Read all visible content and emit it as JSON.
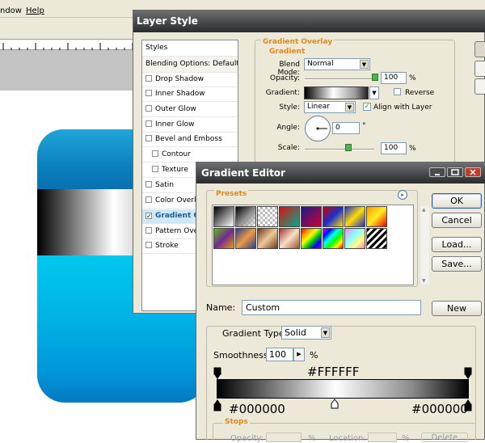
{
  "menubar": {
    "items": [
      "ndow",
      "Help"
    ]
  },
  "layer_style": {
    "title": "Layer Style",
    "list_header": "Styles",
    "items": [
      {
        "label": "Blending Options: Default",
        "checkbox": false
      },
      {
        "label": "Drop Shadow",
        "checkbox": true
      },
      {
        "label": "Inner Shadow",
        "checkbox": true
      },
      {
        "label": "Outer Glow",
        "checkbox": true
      },
      {
        "label": "Inner Glow",
        "checkbox": true
      },
      {
        "label": "Bevel and Emboss",
        "checkbox": true
      },
      {
        "label": "Contour",
        "checkbox": true
      },
      {
        "label": "Texture",
        "checkbox": true
      },
      {
        "label": "Satin",
        "checkbox": true
      },
      {
        "label": "Color Overla",
        "checkbox": true
      },
      {
        "label": "Gradient Ove",
        "checkbox": true,
        "checked": true,
        "selected": true
      },
      {
        "label": "Pattern Overl",
        "checkbox": true
      },
      {
        "label": "Stroke",
        "checkbox": true
      }
    ],
    "gradient_overlay": {
      "group_title": "Gradient Overlay",
      "subgroup_title": "Gradient",
      "blend_mode_label": "Blend Mode:",
      "blend_mode": "Normal",
      "opacity_label": "Opacity:",
      "opacity": "100",
      "percent": "%",
      "gradient_label": "Gradient:",
      "reverse_label": "Reverse",
      "style_label": "Style:",
      "style": "Linear",
      "align_label": "Align with Layer",
      "angle_label": "Angle:",
      "angle": "0",
      "degree": "°",
      "scale_label": "Scale:",
      "scale": "100"
    }
  },
  "gradient_editor": {
    "title": "Gradient Editor",
    "presets_label": "Presets",
    "buttons": {
      "ok": "OK",
      "cancel": "Cancel",
      "load": "Load...",
      "save": "Save...",
      "new": "New"
    },
    "name_label": "Name:",
    "name_value": "Custom",
    "gradient_type_label": "Gradient Type:",
    "gradient_type": "Solid",
    "smoothness_label": "Smoothness:",
    "smoothness": "100",
    "percent": "%",
    "top_stop_label": "#FFFFFF",
    "left_stop_label": "#000000",
    "right_stop_label": "#000000",
    "stops_label": "Stops",
    "opacity_label": "Opacity:",
    "location_label": "Location:",
    "delete_label": "Delete"
  },
  "colors": {
    "accent_orange": "#e08a1a",
    "title_bar": "#2a2b2d",
    "selection": "#cfe8f7",
    "icon_blue": "#00b4e6"
  }
}
